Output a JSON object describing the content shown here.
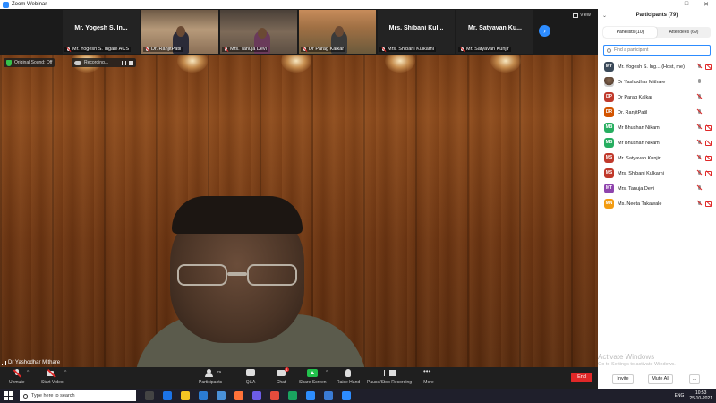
{
  "window": {
    "title": "Zoom Webinar",
    "minimize": "—",
    "maximize": "□",
    "close": "✕"
  },
  "strip": {
    "thumbs": [
      {
        "name": "Mr. Yogesh S. In...",
        "label": "Mr. Yogesh S. Ingale ACS",
        "kind": "name"
      },
      {
        "name": "",
        "label": "Dr. RanjitPatil",
        "kind": "video"
      },
      {
        "name": "",
        "label": "Mrs. Tanuja Devi",
        "kind": "video"
      },
      {
        "name": "",
        "label": "Dr Parag Kalkar",
        "kind": "video"
      },
      {
        "name": "Mrs. Shibani Kul...",
        "label": "Mrs. Shibani Kulkarni",
        "kind": "name"
      },
      {
        "name": "Mr. Satyavan Ku...",
        "label": "Mr. Satyavan Kunjir",
        "kind": "name"
      }
    ],
    "view_label": "View",
    "next_icon": "›"
  },
  "main_video": {
    "sound_label": "Original Sound: Off",
    "recording_label": "Recording...",
    "speaker_name": "Dr Yashodhar Mithare"
  },
  "toolbar": {
    "unmute": "Unmute",
    "start_video": "Start Video",
    "participants": "Participants",
    "participant_count": "79",
    "qa": "Q&A",
    "chat": "Chat",
    "chat_badge": "1",
    "share_screen": "Share Screen",
    "raise_hand": "Raise Hand",
    "pause_stop_recording": "Pause/Stop Recording",
    "more": "More",
    "end": "End",
    "caret": "^"
  },
  "panel": {
    "title": "Participants (79)",
    "collapse_icon": "⌄",
    "tabs": [
      {
        "label": "Panelists (10)",
        "active": true
      },
      {
        "label": "Attendees (69)",
        "active": false
      }
    ],
    "search_placeholder": "Find a participant",
    "participants": [
      {
        "initials": "MY",
        "color": "#3b4a5a",
        "name": "Mr. Yogesh S. Ing... (Host, me)",
        "mic_muted": true,
        "video_off": true
      },
      {
        "initials": "",
        "color": "photo",
        "name": "Dr Yashodhar Mithare",
        "mic_muted": false,
        "video_off": false
      },
      {
        "initials": "DP",
        "color": "#c0392b",
        "name": "Dr Parag Kalkar",
        "mic_muted": true,
        "video_off": false
      },
      {
        "initials": "DR",
        "color": "#d35400",
        "name": "Dr. RanjitPatil",
        "mic_muted": true,
        "video_off": false
      },
      {
        "initials": "MB",
        "color": "#27ae60",
        "name": "Mr Bhushan Nikam",
        "mic_muted": true,
        "video_off": true
      },
      {
        "initials": "MB",
        "color": "#27ae60",
        "name": "Mr Bhushan Nikam",
        "mic_muted": true,
        "video_off": true
      },
      {
        "initials": "MS",
        "color": "#c0392b",
        "name": "Mr. Satyavan Kunjir",
        "mic_muted": true,
        "video_off": true
      },
      {
        "initials": "MS",
        "color": "#c0392b",
        "name": "Mrs. Shibani Kulkarni",
        "mic_muted": true,
        "video_off": true
      },
      {
        "initials": "MT",
        "color": "#8e44ad",
        "name": "Mrs. Tanuja Devi",
        "mic_muted": true,
        "video_off": false
      },
      {
        "initials": "MN",
        "color": "#f39c12",
        "name": "Ms. Neeta Takawale",
        "mic_muted": true,
        "video_off": true
      }
    ],
    "watermark_title": "Activate Windows",
    "watermark_sub": "Go to Settings to activate Windows.",
    "invite": "Invite",
    "mute_all": "Mute All",
    "more": "..."
  },
  "taskbar": {
    "search_placeholder": "Type here to search",
    "language": "ENG",
    "time": "10:53",
    "date": "25-10-2021",
    "app_colors": [
      "#444",
      "#1b73e8",
      "#f3c623",
      "#2b7cd3",
      "#4a90d9",
      "#ff7139",
      "#6c5ce7",
      "#e74c3c",
      "#1aa260",
      "#2d8cff",
      "#3a7bd5",
      "#2d8cff"
    ]
  },
  "colors": {
    "accent": "#2d8cff",
    "end_red": "#e02828",
    "share_green": "#23c24d"
  }
}
